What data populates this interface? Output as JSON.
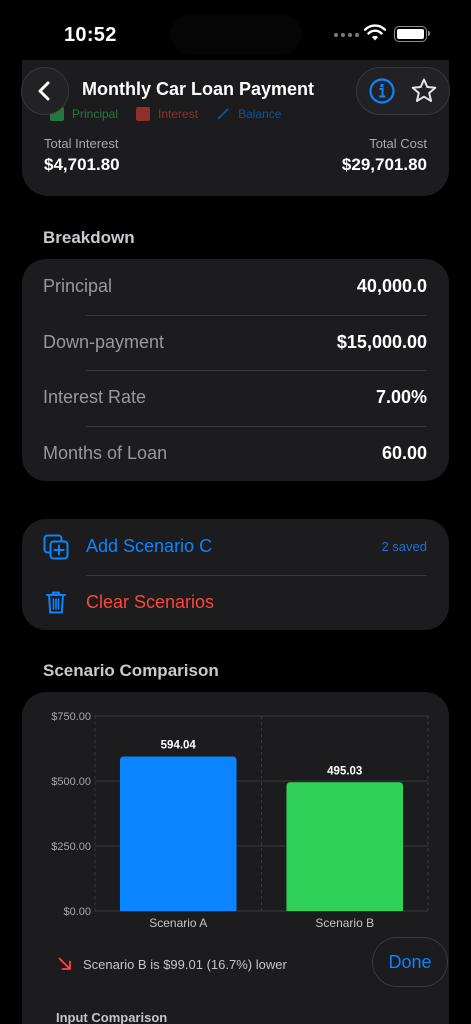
{
  "status": {
    "time": "10:52"
  },
  "nav": {
    "title": "Monthly Car Loan Payment"
  },
  "legend": [
    {
      "label": "Principal",
      "color": "#30d158"
    },
    {
      "label": "Interest",
      "color": "#ff453a"
    },
    {
      "label": "Balance",
      "color": "#0a84ff"
    }
  ],
  "summary": {
    "total_interest_label": "Total Interest",
    "total_interest_value": "$4,701.80",
    "total_cost_label": "Total Cost",
    "total_cost_value": "$29,701.80"
  },
  "breakdown": {
    "title": "Breakdown",
    "rows": [
      {
        "label": "Principal",
        "value": "40,000.0"
      },
      {
        "label": "Down-payment",
        "value": "$15,000.00"
      },
      {
        "label": "Interest Rate",
        "value": "7.00%"
      },
      {
        "label": "Months of Loan",
        "value": "60.00"
      }
    ]
  },
  "scenarios": {
    "add_label": "Add Scenario C",
    "saved_count": "2 saved",
    "clear_label": "Clear Scenarios"
  },
  "comparison": {
    "title": "Scenario Comparison",
    "note": "Scenario B is $99.01 (16.7%) lower",
    "input_comparison_label": "Input Comparison",
    "done_label": "Done"
  },
  "colors": {
    "accent": "#0a84ff",
    "destructive": "#ff453a",
    "scenario_a": "#0a84ff",
    "scenario_b": "#30d158"
  },
  "chart_data": {
    "type": "bar",
    "categories": [
      "Scenario A",
      "Scenario B"
    ],
    "values": [
      594.04,
      495.03
    ],
    "value_labels": [
      "594.04",
      "495.03"
    ],
    "y_ticks": [
      "$0.00",
      "$250.00",
      "$500.00",
      "$750.00"
    ],
    "y_tick_values": [
      0,
      250,
      500,
      750
    ],
    "ylim": [
      0,
      750
    ],
    "grid": true
  }
}
